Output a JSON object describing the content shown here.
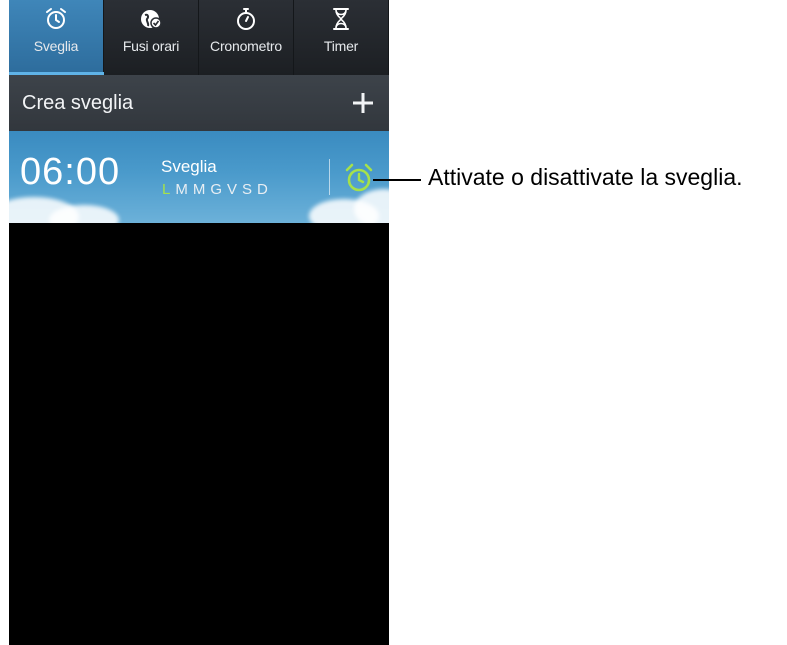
{
  "tabs": [
    {
      "label": "Sveglia",
      "icon": "alarm-clock-icon",
      "active": true
    },
    {
      "label": "Fusi orari",
      "icon": "world-clock-icon",
      "active": false
    },
    {
      "label": "Cronometro",
      "icon": "stopwatch-icon",
      "active": false
    },
    {
      "label": "Timer",
      "icon": "hourglass-icon",
      "active": false
    }
  ],
  "create_alarm": {
    "label": "Crea sveglia",
    "icon": "plus-icon"
  },
  "alarms": [
    {
      "time": "06:00",
      "name": "Sveglia",
      "days": [
        {
          "letter": "L",
          "active": true
        },
        {
          "letter": "M",
          "active": false
        },
        {
          "letter": "M",
          "active": false
        },
        {
          "letter": "G",
          "active": false
        },
        {
          "letter": "V",
          "active": false
        },
        {
          "letter": "S",
          "active": false
        },
        {
          "letter": "D",
          "active": false
        }
      ],
      "toggle_icon": "alarm-clock-icon",
      "enabled": true
    }
  ],
  "annotation": {
    "text": "Attivate o disattivate la sveglia."
  },
  "colors": {
    "active_tab": "#3f86b9",
    "active_day": "#a6e14a",
    "toggle_on": "#a6e14a"
  }
}
